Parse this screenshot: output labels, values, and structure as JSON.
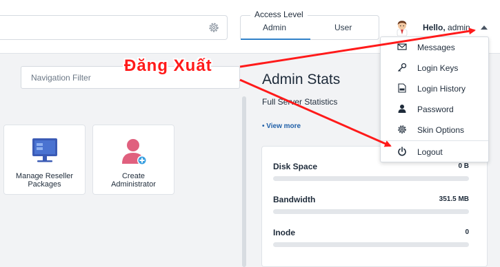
{
  "topbar": {
    "access_level": {
      "title": "Access Level",
      "tabs": [
        "Admin",
        "User"
      ],
      "selected": "Admin"
    },
    "user": {
      "greeting": "Hello,",
      "username": "admin"
    }
  },
  "left": {
    "nav_filter_placeholder": "Navigation Filter",
    "cards": [
      {
        "label_line1": "Manage Reseller",
        "label_line2": "Packages",
        "icon": "monitor-icon"
      },
      {
        "label_line1": "Create",
        "label_line2": "Administrator",
        "icon": "add-user-icon"
      }
    ]
  },
  "stats": {
    "title": "Admin Stats",
    "subtitle": "Full Server Statistics",
    "view_more": "• View more",
    "rows": [
      {
        "name": "Disk Space",
        "value": "0 B"
      },
      {
        "name": "Bandwidth",
        "value": "351.5 MB"
      },
      {
        "name": "Inode",
        "value": "0"
      }
    ]
  },
  "dropdown": {
    "items": [
      {
        "label": "Messages",
        "icon": "envelope-icon"
      },
      {
        "label": "Login Keys",
        "icon": "key-icon"
      },
      {
        "label": "Login History",
        "icon": "log-icon"
      },
      {
        "label": "Password",
        "icon": "user-icon"
      },
      {
        "label": "Skin Options",
        "icon": "gear-icon"
      },
      {
        "label": "Logout",
        "icon": "power-icon"
      }
    ]
  },
  "annotation": {
    "text": "Đăng Xuất",
    "color": "#ff1a1a"
  },
  "colors": {
    "accent": "#2f80c8",
    "link": "#1f5fa8",
    "card_icon_blue": "#3b5bb5",
    "card_icon_pink": "#e0607e"
  }
}
